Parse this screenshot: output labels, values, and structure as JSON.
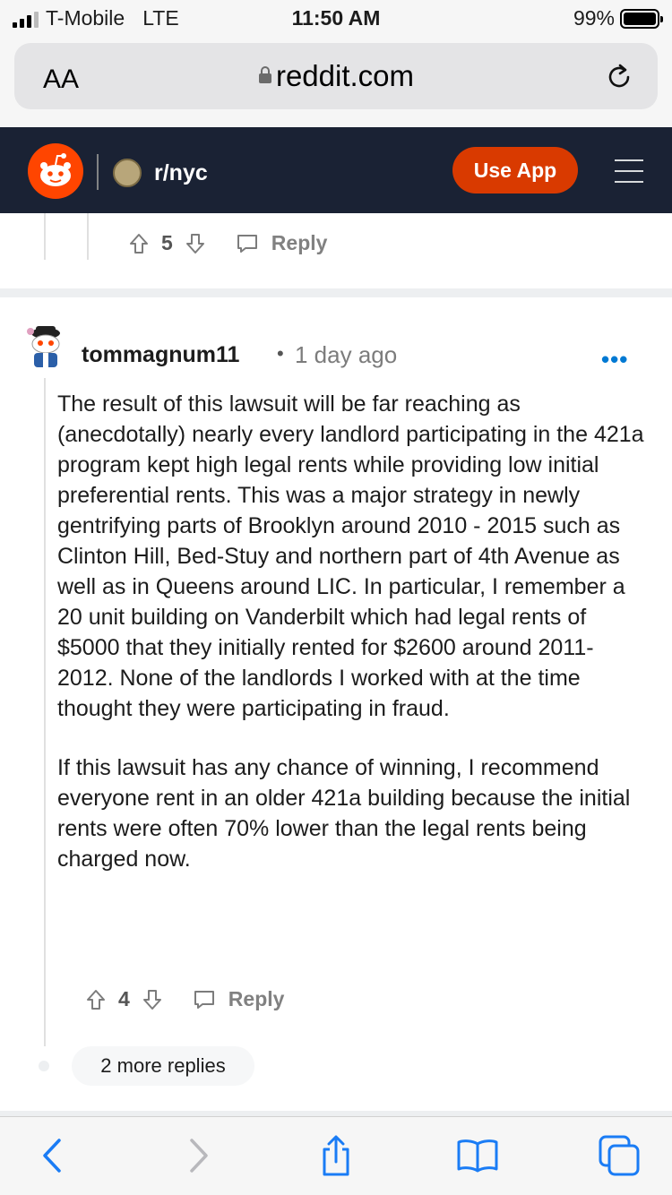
{
  "status_bar": {
    "carrier": "T-Mobile",
    "network": "LTE",
    "time": "11:50 AM",
    "battery": "99%",
    "battery_level": 0.99
  },
  "browser": {
    "text_size_label": "AA",
    "url": "reddit.com"
  },
  "reddit_header": {
    "subreddit": "r/nyc",
    "use_app_label": "Use App"
  },
  "previous_comment": {
    "vote_count": "5",
    "reply_label": "Reply"
  },
  "comment": {
    "username": "tommagnum11",
    "separator": "•",
    "timestamp": "1 day ago",
    "more_options": "•••",
    "paragraphs": [
      "The result of this lawsuit will be far reaching as (anecdotally) nearly every landlord participating in the 421a program kept high legal rents while providing low initial preferential rents. This was a major strategy in newly gentrifying parts of Brooklyn around 2010 - 2015 such as Clinton Hill, Bed-Stuy and northern part of 4th Avenue as well as in Queens around LIC. In particular, I remember a 20 unit building on Vanderbilt which had legal rents of $5000 that they initially rented for $2600 around 2011-2012. None of the landlords I worked with at the time thought they were participating in fraud.",
      "If this lawsuit has any chance of winning, I recommend everyone rent in an older 421a building because the initial rents were often 70% lower than the legal rents being charged now."
    ],
    "vote_count": "4",
    "reply_label": "Reply",
    "more_replies_label": "2 more replies"
  },
  "colors": {
    "reddit_header_bg": "#1a2234",
    "reddit_orange": "#ff4500",
    "use_app_bg": "#d93a00",
    "link_blue": "#0079d3",
    "safari_blue": "#1a7cf5"
  },
  "icons": {
    "reload": "reload-icon",
    "back": "chevron-left-icon",
    "forward": "chevron-right-icon",
    "share": "share-icon",
    "bookmarks": "book-icon",
    "tabs": "tabs-icon"
  }
}
